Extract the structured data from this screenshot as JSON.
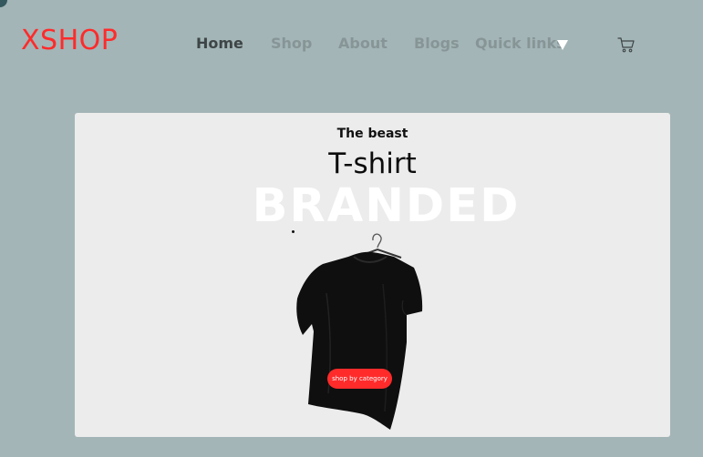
{
  "brand": {
    "logo_text": "XSHOP",
    "logo_color": "#ff2b2b"
  },
  "nav": {
    "items": [
      {
        "label": "Home",
        "active": true
      },
      {
        "label": "Shop",
        "active": false
      },
      {
        "label": "About",
        "active": false
      },
      {
        "label": "Blogs",
        "active": false
      },
      {
        "label": "Quick links",
        "active": false
      }
    ],
    "dropdown_icon": "caret-down-icon",
    "cart_icon": "cart-icon"
  },
  "hero": {
    "subtitle": "The beast",
    "title": "T-shirt",
    "overlay_text": "BRANDED",
    "product_image": "black-tshirt-on-hanger",
    "cta_label": "shop by category",
    "cta_color": "#ff2b2b"
  },
  "colors": {
    "page_background": "#a3b5b7",
    "card_background": "#ececec",
    "nav_active": "#3e4546",
    "nav_inactive": "#879597"
  }
}
